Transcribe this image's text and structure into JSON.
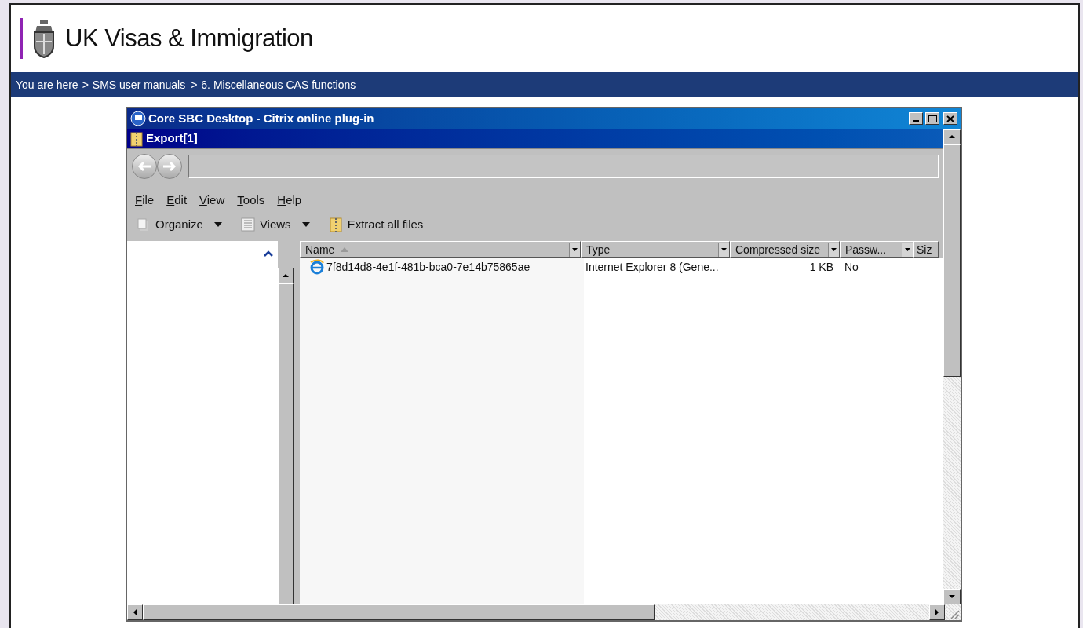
{
  "header": {
    "title": "UK Visas & Immigration"
  },
  "breadcrumb": [
    {
      "kind": "text",
      "label": "You are here"
    },
    {
      "kind": "separator",
      "label": ">"
    },
    {
      "kind": "link",
      "label": "SMS user manuals"
    },
    {
      "kind": "separator",
      "label": ">"
    },
    {
      "kind": "link",
      "label": "6. Miscellaneous CAS functions"
    }
  ],
  "window": {
    "title": "Core SBC Desktop - Citrix online plug-in",
    "subtitle": "Export[1]"
  },
  "menu": [
    {
      "label": "File"
    },
    {
      "label": "Edit"
    },
    {
      "label": "View"
    },
    {
      "label": "Tools"
    },
    {
      "label": "Help"
    }
  ],
  "toolbar": [
    {
      "kind": "organize",
      "label": "Organize",
      "dropdown": true
    },
    {
      "kind": "views",
      "label": "Views",
      "dropdown": true
    },
    {
      "kind": "extract",
      "label": "Extract all files",
      "dropdown": false
    }
  ],
  "table": {
    "columns": [
      {
        "label": "Name",
        "sorted": true
      },
      {
        "label": "Type",
        "sorted": false
      },
      {
        "label": "Compressed size",
        "sorted": false
      },
      {
        "label": "Passw...",
        "sorted": false
      },
      {
        "label": "Siz",
        "sorted": false
      }
    ],
    "rows": [
      {
        "name": "7f8d14d8-4e1f-481b-bca0-7e14b75865ae",
        "type": "Internet Explorer 8 (Gene...",
        "compressed_size": "1 KB",
        "password": "No"
      }
    ]
  }
}
